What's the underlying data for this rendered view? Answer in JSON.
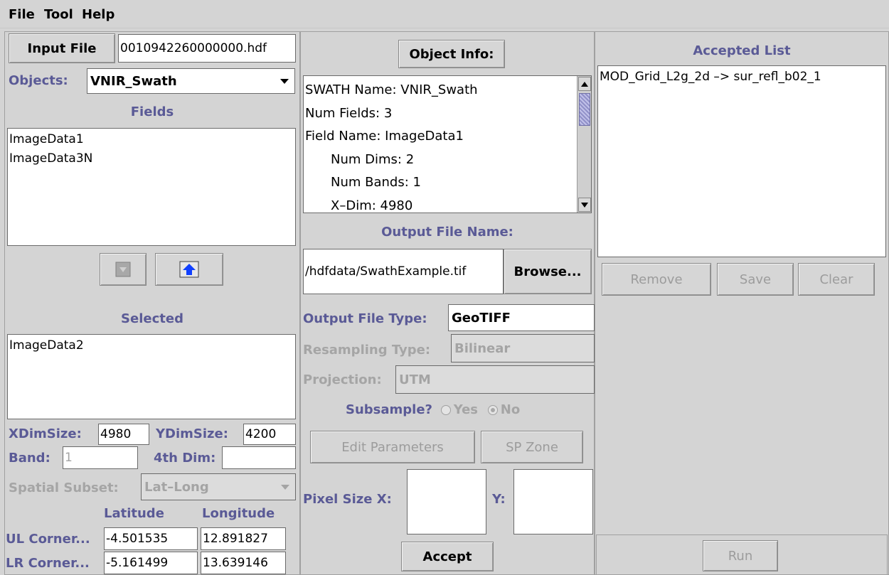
{
  "menu": {
    "file": "File",
    "tool": "Tool",
    "help": "Help"
  },
  "left": {
    "input_file_label": "Input File",
    "input_file_value": "0010942260000000.hdf",
    "objects_label": "Objects:",
    "objects_value": "VNIR_Swath",
    "fields_label": "Fields",
    "fields": [
      "ImageData1",
      "ImageData3N"
    ],
    "selected_label": "Selected",
    "selected": [
      "ImageData2"
    ],
    "xdimsize_label": "XDimSize:",
    "xdimsize_value": "4980",
    "ydimsize_label": "YDimSize:",
    "ydimsize_value": "4200",
    "band_label": "Band:",
    "band_value": "1",
    "fourth_dim_label": "4th Dim:",
    "fourth_dim_value": "",
    "spatial_subset_label": "Spatial Subset:",
    "spatial_subset_value": "Lat–Long",
    "latitude_label": "Latitude",
    "longitude_label": "Longitude",
    "ul_corner_label": "UL Corner...",
    "ul_lat": "-4.501535",
    "ul_long": "12.891827",
    "lr_corner_label": "LR Corner...",
    "lr_lat": "-5.161499",
    "lr_long": "13.639146"
  },
  "middle": {
    "object_info_label": "Object Info:",
    "info_lines": [
      "SWATH Name:  VNIR_Swath",
      "Num Fields:  3",
      "Field Name:  ImageData1",
      "Num Dims:  2",
      "Num Bands:  1",
      "X–Dim:  4980"
    ],
    "output_file_name_label": "Output File Name:",
    "output_file_value": "/hdfdata/SwathExample.tif",
    "browse_label": "Browse...",
    "output_file_type_label": "Output File Type:",
    "output_file_type_value": "GeoTIFF",
    "resampling_label": "Resampling Type:",
    "resampling_value": "Bilinear",
    "projection_label": "Projection:",
    "projection_value": "UTM",
    "subsample_label": "Subsample?",
    "yes_label": "Yes",
    "no_label": "No",
    "edit_parameters_label": "Edit Parameters",
    "sp_zone_label": "SP Zone",
    "pixel_size_x_label": "Pixel Size X:",
    "pixel_size_y_label": "Y:",
    "accept_label": "Accept"
  },
  "right": {
    "accepted_list_label": "Accepted List",
    "accepted": [
      "MOD_Grid_L2g_2d –> sur_refl_b02_1"
    ],
    "remove_label": "Remove",
    "save_label": "Save",
    "clear_label": "Clear",
    "run_label": "Run"
  }
}
